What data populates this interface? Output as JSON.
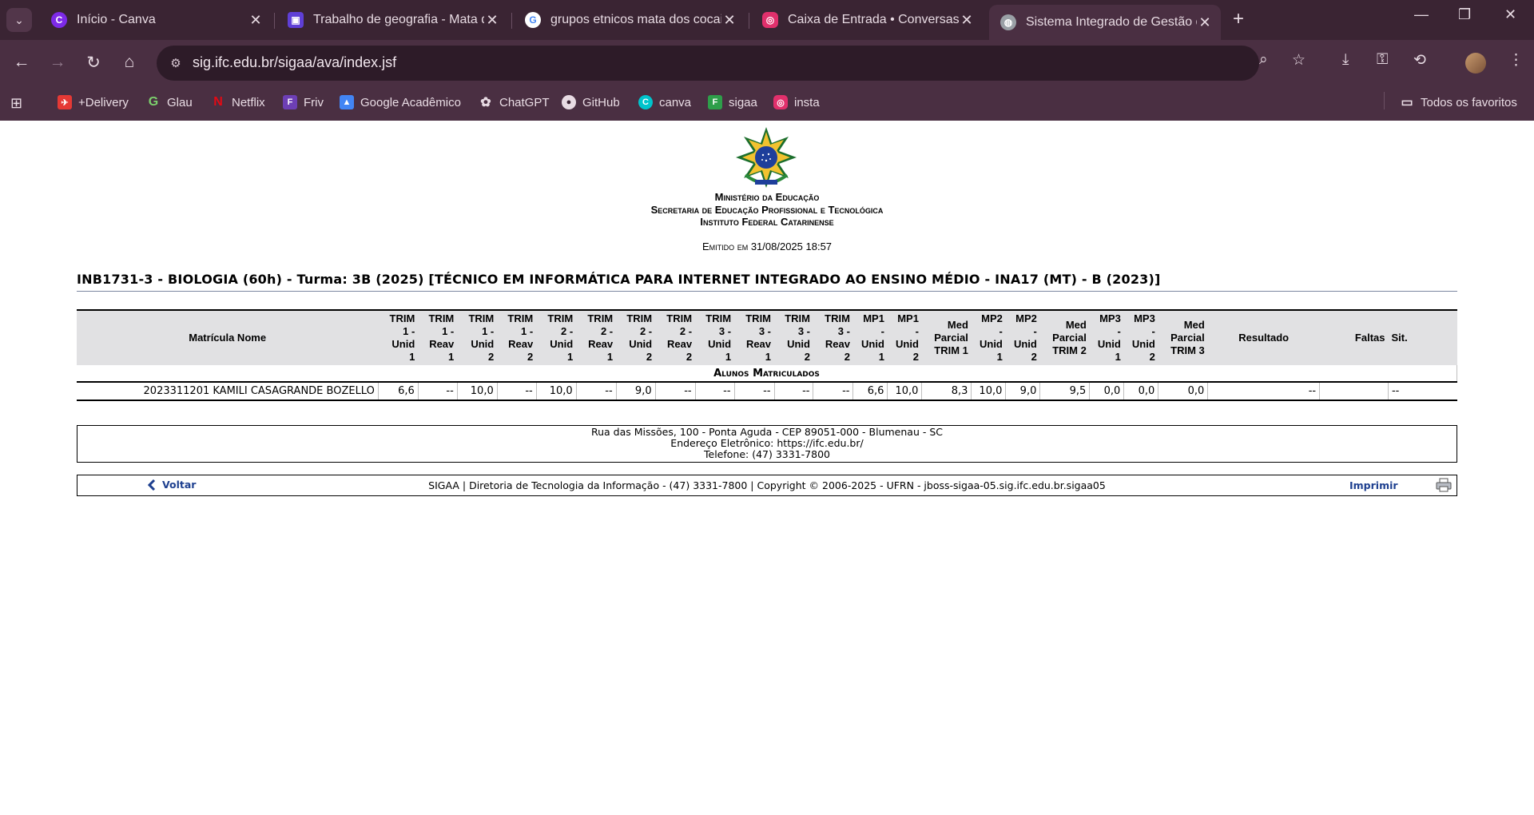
{
  "browser": {
    "tabs": [
      {
        "title": "Início - Canva",
        "icon": "canva-icon",
        "color": "#7d2ae8",
        "active": false
      },
      {
        "title": "Trabalho de geografia - Mata d",
        "icon": "canva-presentation-icon",
        "color": "#5f3fd6",
        "active": false
      },
      {
        "title": "grupos etnicos mata dos cocais",
        "icon": "google-icon",
        "color": "#ffffff",
        "active": false
      },
      {
        "title": "Caixa de Entrada • Conversas",
        "icon": "instagram-icon",
        "color": "#e1306c",
        "active": false
      },
      {
        "title": "Sistema Integrado de Gestão de",
        "icon": "globe-icon",
        "color": "#9aa0a6",
        "active": true
      }
    ],
    "url": "sig.ifc.edu.br/sigaa/ava/index.jsf",
    "bookmarks": [
      {
        "label": "+Delivery",
        "icon": "delivery-icon",
        "color": "#e53935"
      },
      {
        "label": "Glau",
        "icon": "glau-icon",
        "color": "#2e7d32"
      },
      {
        "label": "Netflix",
        "icon": "netflix-icon",
        "color": "#e50914"
      },
      {
        "label": "Friv",
        "icon": "friv-icon",
        "color": "#6d3fb5"
      },
      {
        "label": "Google Acadêmico",
        "icon": "scholar-icon",
        "color": "#4285f4"
      },
      {
        "label": "ChatGPT",
        "icon": "chatgpt-icon",
        "color": "#e8dbe3"
      },
      {
        "label": "GitHub",
        "icon": "github-icon",
        "color": "#e8dbe3"
      },
      {
        "label": "canva",
        "icon": "canva-icon",
        "color": "#00c4cc"
      },
      {
        "label": "sigaa",
        "icon": "sigaa-icon",
        "color": "#2e9e4a"
      },
      {
        "label": "insta",
        "icon": "instagram-icon",
        "color": "#e1306c"
      }
    ],
    "all_bookmarks_label": "Todos os favoritos"
  },
  "page": {
    "header": {
      "line1": "Ministério da Educação",
      "line2": "Secretaria de Educação Profissional e Tecnológica",
      "line3": "Instituto Federal Catarinense"
    },
    "emitido": "Emitido em 31/08/2025 18:57",
    "turma_title": "INB1731-3 - BIOLOGIA (60h) - Turma: 3B (2025) [TÉCNICO EM INFORMÁTICA PARA INTERNET INTEGRADO AO ENSINO MÉDIO - INA17 (MT) - B (2023)]",
    "table": {
      "caption": "Alunos Matriculados",
      "headers": {
        "matricula_nome": "Matrícula Nome",
        "resultado": "Resultado",
        "faltas": "Faltas",
        "sit": "Sit."
      },
      "row": {
        "matricula": "2023311201",
        "nome": "KAMILI CASAGRANDE BOZELLO",
        "values": [
          "6,6",
          "--",
          "10,0",
          "--",
          "10,0",
          "--",
          "9,0",
          "--",
          "--",
          "--",
          "--",
          "--",
          "6,6",
          "10,0",
          "8,3",
          "10,0",
          "9,0",
          "9,5",
          "0,0",
          "0,0",
          "0,0"
        ],
        "resultado": "--",
        "faltas": "",
        "sit": "--"
      }
    },
    "address": {
      "line1": "Rua das Missões, 100 - Ponta Aguda - CEP 89051-000 - Blumenau - SC",
      "line2": "Endereço Eletrônico: https://ifc.edu.br/",
      "line3": "Telefone: (47) 3331-7800"
    },
    "footer": {
      "voltar": "Voltar",
      "text": "SIGAA | Diretoria de Tecnologia da Informação - (47) 3331-7800 | Copyright © 2006-2025 - UFRN - jboss-sigaa-05.sig.ifc.edu.br.sigaa05",
      "imprimir": "Imprimir"
    }
  }
}
